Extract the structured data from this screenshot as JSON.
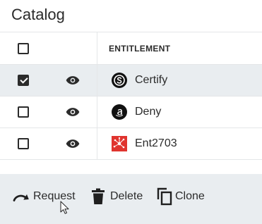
{
  "title": "Catalog",
  "table": {
    "header": "ENTITLEMENT",
    "rows": [
      {
        "label": "Certify",
        "checked": true,
        "icon": "s-icon",
        "selected": true
      },
      {
        "label": "Deny",
        "checked": false,
        "icon": "amazon-icon",
        "selected": false
      },
      {
        "label": "Ent2703",
        "checked": false,
        "icon": "network-icon",
        "selected": false
      }
    ]
  },
  "toolbar": {
    "request_label": "Request",
    "delete_label": "Delete",
    "clone_label": "Clone"
  },
  "colors": {
    "selected_row": "#e9edf0",
    "toolbar_bg": "#e9edf0",
    "ent2703_icon": "#e0342f"
  }
}
